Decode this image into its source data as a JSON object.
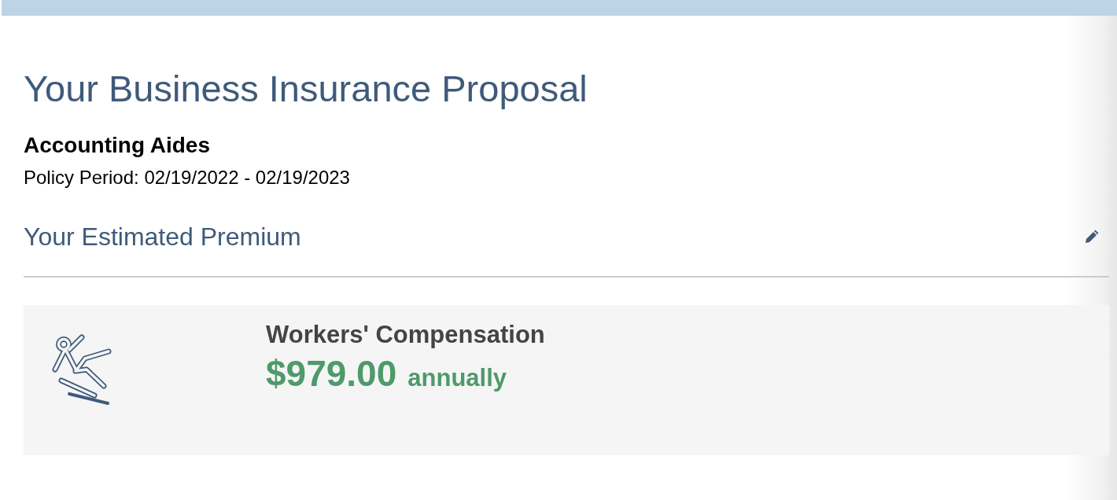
{
  "page": {
    "title": "Your Business Insurance Proposal",
    "business_name": "Accounting Aides",
    "policy_period": "Policy Period: 02/19/2022 - 02/19/2023"
  },
  "premium_section": {
    "heading": "Your Estimated Premium",
    "policies": [
      {
        "kind": "workers_comp",
        "name": "Workers' Compensation",
        "amount": "$979.00",
        "frequency": "annually"
      }
    ]
  }
}
